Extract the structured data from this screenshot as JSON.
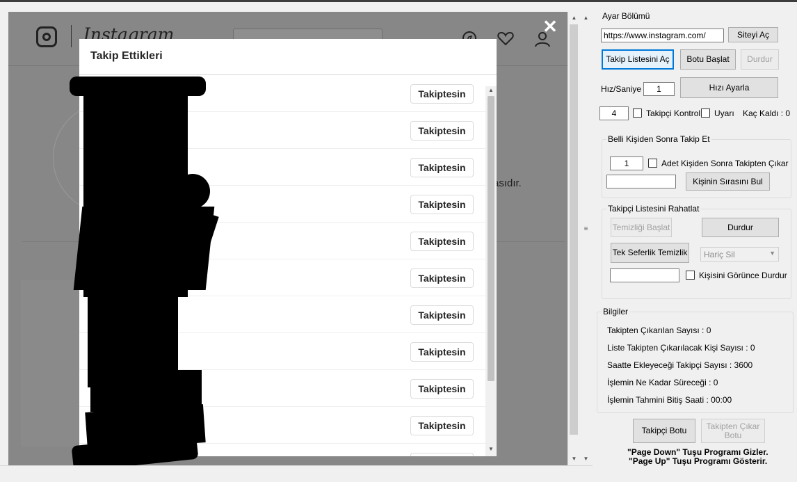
{
  "browser": {
    "wordmark": "Instagram",
    "background_text": "asıdır.",
    "close_symbol": "✕"
  },
  "modal": {
    "title": "Takip Ettikleri",
    "rows": [
      {
        "button": "Takiptesin"
      },
      {
        "button": "Takiptesin"
      },
      {
        "button": "Takiptesin"
      },
      {
        "button": "Takiptesin"
      },
      {
        "button": "Takiptesin"
      },
      {
        "button": "Takiptesin"
      },
      {
        "button": "Takiptesin"
      },
      {
        "button": "Takiptesin"
      },
      {
        "button": "Takiptesin"
      },
      {
        "button": "Takiptesin"
      }
    ]
  },
  "panel": {
    "settings": {
      "title": "Ayar Bölümü",
      "url_value": "https://www.instagram.com/",
      "open_site_button": "Siteyi Aç",
      "open_follow_list_button": "Takip Listesini Aç",
      "start_bot_button": "Botu Başlat",
      "stop_button": "Durdur",
      "speed_label": "Hız/Saniye :",
      "speed_value": "1",
      "set_speed_button": "Hızı Ayarla",
      "follower_control_value": "4",
      "follower_control_label": "Takipçi Kontrol",
      "warn_label": "Uyarı",
      "remaining_label": "Kaç Kaldı : 0"
    },
    "unfollow_after": {
      "title": "Belli Kişiden Sonra Takip Et",
      "count_value": "1",
      "checkbox_label": "Adet Kişiden Sonra Takipten Çıkar",
      "name_value": "",
      "find_order_button": "Kişinin Sırasını Bul"
    },
    "relax_list": {
      "title": "Takipçi Listesini Rahatlat",
      "start_cleanup_button": "Temizliği Başlat",
      "stop_button": "Durdur",
      "single_cleanup_button": "Tek Seferlik Temizlik",
      "select_value": "Hariç Sil",
      "person_value": "",
      "stop_on_see_label": "Kişisini Görünce Durdur"
    },
    "info": {
      "title": "Bilgiler",
      "lines": [
        "Takipten Çıkarılan Sayısı :   0",
        "Liste Takipten Çıkarılacak Kişi Sayısı :  0",
        "Saatte Ekleyeceği Takipçi Sayısı :    3600",
        "İşlemin Ne Kadar Süreceği :    0",
        "İşlemin Tahmini Bitiş Saati :    00:00"
      ]
    },
    "bottom": {
      "follower_bot_button": "Takipçi Botu",
      "unfollow_bot_button": "Takipten Çıkar Botu",
      "hint_line1": "\"Page Down\" Tuşu Programı Gizler.",
      "hint_line2": "\"Page Up\" Tuşu Programı Gösterir."
    }
  }
}
